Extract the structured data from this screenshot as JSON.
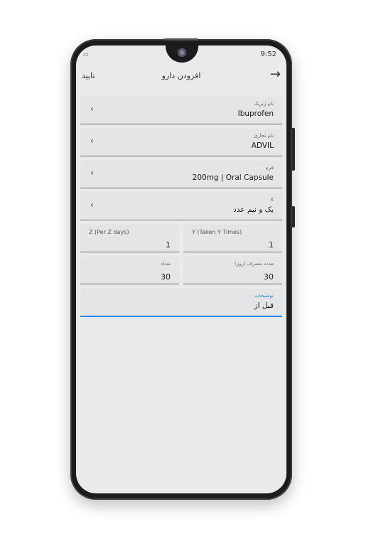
{
  "status": {
    "time": "9:52"
  },
  "appbar": {
    "confirm": "تایید",
    "title": "افزودن دارو",
    "back": "→"
  },
  "fields": {
    "generic": {
      "label": "نام ژنریک",
      "value": "Ibuprofen"
    },
    "brand": {
      "label": "نام تجاری",
      "value": "ADVIL"
    },
    "form": {
      "label": "فرم",
      "value": "200mg | Oral Capsule"
    },
    "x": {
      "label": "X",
      "value": "یک و نیم عدد"
    },
    "z": {
      "label": "Z (Per Z days)",
      "value": "1"
    },
    "y": {
      "label": "Y (Taken Y Times)",
      "value": "1"
    },
    "count": {
      "label": "تعداد",
      "value": "30"
    },
    "duration": {
      "label": "مدت مصرف (روز)",
      "value": "30"
    },
    "notes": {
      "label": "توضیحات",
      "value": "قبل از"
    }
  },
  "icons": {
    "chevron": "chevron-left-icon",
    "back": "arrow-right-icon"
  },
  "colors": {
    "accent": "#1e88e5",
    "screen": "#e9eaeb"
  }
}
